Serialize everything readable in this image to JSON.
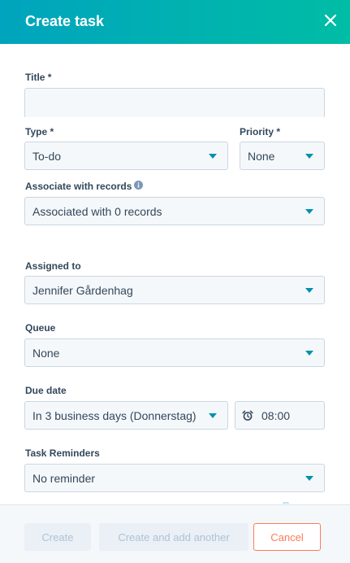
{
  "header": {
    "title": "Create task"
  },
  "fields": {
    "title": {
      "label": "Title *",
      "value": ""
    },
    "type": {
      "label": "Type *",
      "value": "To-do"
    },
    "priority": {
      "label": "Priority *",
      "value": "None"
    },
    "associate": {
      "label": "Associate with records",
      "value": "Associated with 0 records"
    },
    "assigned": {
      "label": "Assigned to",
      "value": "Jennifer Gårdenhag"
    },
    "queue": {
      "label": "Queue",
      "value": "None"
    },
    "due_date": {
      "label": "Due date",
      "value": "In 3 business days (Donnerstag)",
      "time": "08:00"
    },
    "reminders": {
      "label": "Task Reminders",
      "value": "No reminder"
    }
  },
  "footer": {
    "create_label": "Create",
    "create_another_label": "Create and add another",
    "cancel_label": "Cancel"
  },
  "colors": {
    "header_gradient_start": "#00a4bd",
    "header_gradient_end": "#00bda5",
    "caret": "#0091ae",
    "cancel": "#ff7a59"
  }
}
